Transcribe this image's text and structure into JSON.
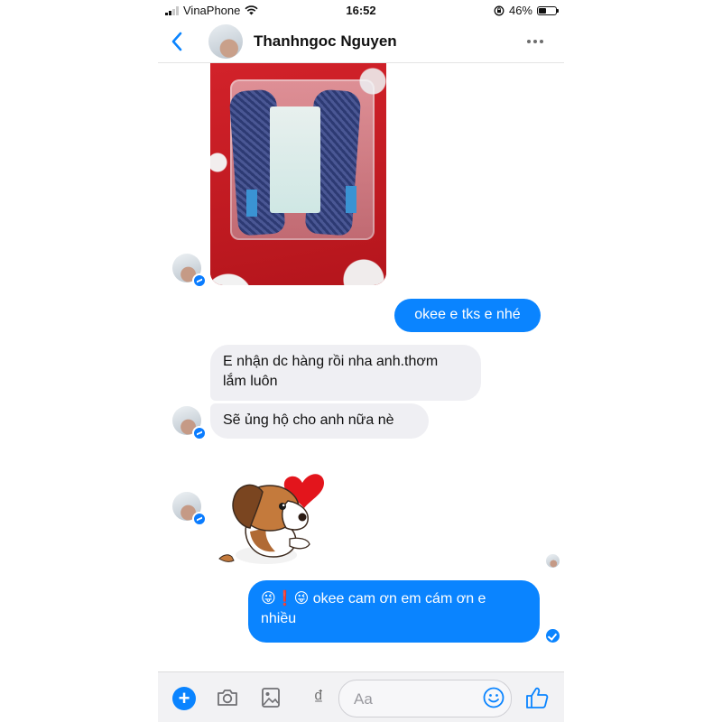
{
  "status_bar": {
    "carrier": "VinaPhone",
    "time": "16:52",
    "battery_percent": "46%",
    "battery_level": 0.46,
    "icons": [
      "signal-icon",
      "wifi-icon",
      "orientation-lock-icon",
      "battery-icon"
    ]
  },
  "header": {
    "contact_name": "Thanhngoc Nguyen",
    "icons": [
      "back-chevron-icon",
      "more-dots-icon"
    ]
  },
  "messages": [
    {
      "direction": "incoming",
      "type": "photo"
    },
    {
      "direction": "outgoing",
      "text": "okee e tks e nhé"
    },
    {
      "direction": "incoming",
      "text_lines": [
        "E nhận dc hàng rồi nha anh.thơm",
        "lắm luôn"
      ]
    },
    {
      "direction": "incoming",
      "text": "Sẽ ủng hộ cho anh nữa nè"
    },
    {
      "direction": "incoming",
      "type": "sticker",
      "sticker": "puppy-heart-sticker"
    },
    {
      "direction": "outgoing",
      "text_lines": [
        "😜❗😜 okee  cam ơn em cám ơn e",
        "nhiều"
      ],
      "status": "delivered"
    }
  ],
  "composer": {
    "placeholder": "Aa",
    "dong_symbol": "₫",
    "icons": [
      "plus-icon",
      "camera-icon",
      "gallery-icon",
      "dong-icon",
      "emoji-icon",
      "thumbs-up-icon"
    ]
  },
  "colors": {
    "accent": "#0a84ff",
    "incoming_bubble": "#efeff3",
    "outgoing_text": "#ffffff"
  }
}
